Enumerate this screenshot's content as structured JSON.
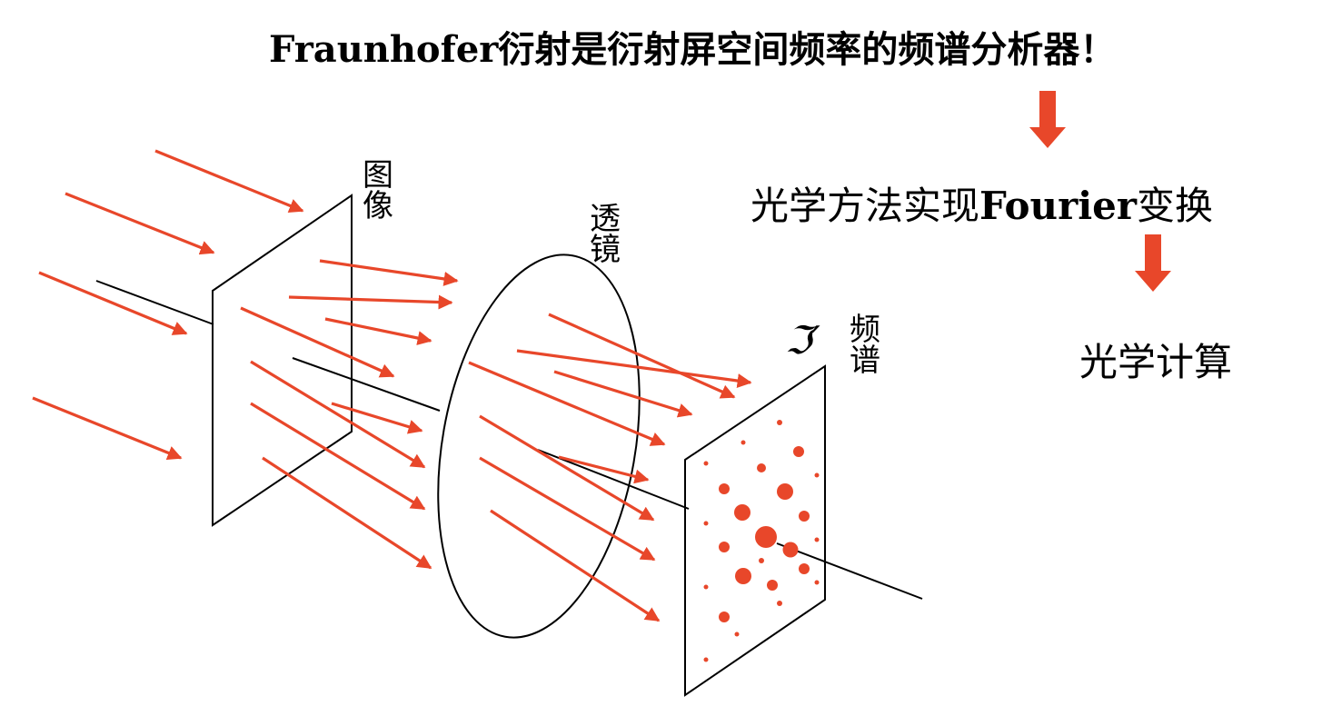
{
  "title": "Fraunhofer衍射是衍射屏空间频率的频谱分析器！",
  "steps": {
    "step1_prefix": "光学方法实现",
    "step1_bold": "Fourier",
    "step1_suffix": "变换",
    "step2": "光学计算"
  },
  "labels": {
    "image": "图像",
    "lens": "透镜",
    "spectrum": "频谱",
    "fourier_symbol": "ℑ′"
  },
  "colors": {
    "accent": "#e8472a",
    "line": "#000000"
  }
}
